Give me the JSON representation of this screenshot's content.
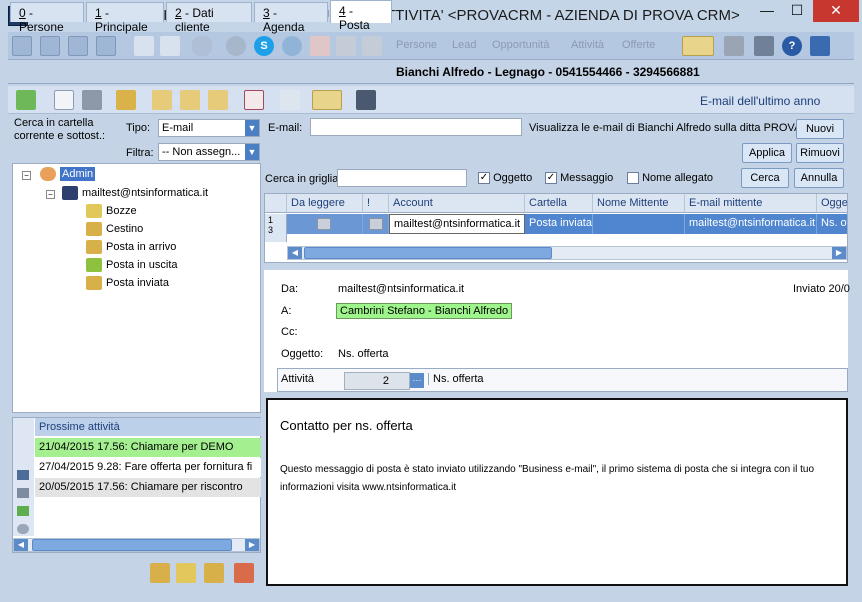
{
  "window": {
    "title": "GESTIONE LEAD / OPPORTUNITA' / ATTIVITA' <PROVACRM - AZIENDA DI PROVA CRM>",
    "app_icon": "B 15",
    "minimize": "—",
    "maximize": "☐",
    "close": "✕"
  },
  "toolbar": {
    "menus": [
      "Persone",
      "Lead",
      "Opportunità",
      "Attività",
      "Offerte"
    ]
  },
  "tabs": [
    {
      "key": "0",
      "label": " - Persone"
    },
    {
      "key": "1",
      "label": " - Principale"
    },
    {
      "key": "2",
      "label": " - Dati cliente"
    },
    {
      "key": "3",
      "label": " - Agenda"
    },
    {
      "key": "4",
      "label": " - Posta"
    }
  ],
  "contact_line": "Bianchi Alfredo   - Legnago - 0541554466 - 3294566881",
  "email_heading": "E-mail dell'ultimo anno",
  "filters": {
    "search_label": "Cerca in cartella corrente e sottost.:",
    "tipo_label": "Tipo:",
    "tipo_value": "E-mail",
    "filtra_label": "Filtra:",
    "filtra_value": "-- Non assegn...",
    "email_label": "E-mail:",
    "email_value": "",
    "visualizza_text": "Visualizza le e-mail di Bianchi Alfredo  sulla ditta PROVACRM",
    "nuovi_btn": "Nuovi",
    "applica_btn": "Applica",
    "rimuovi_btn": "Rimuovi"
  },
  "tree": {
    "root": "Admin",
    "account": "mailtest@ntsinformatica.it",
    "folders": [
      "Bozze",
      "Cestino",
      "Posta in arrivo",
      "Posta in uscita",
      "Posta inviata"
    ]
  },
  "activities": {
    "header": "Prossime attività",
    "items": [
      {
        "text": "21/04/2015 17.56: Chiamare per DEMO",
        "color": "#a4ef8f"
      },
      {
        "text": "27/04/2015 9.28: Fare offerta per fornitura fi",
        "color": "#ffffff"
      },
      {
        "text": "20/05/2015 17.56: Chiamare per riscontro",
        "color": "#e3e3e3"
      }
    ]
  },
  "grid_search": {
    "label": "Cerca in griglia",
    "value": "",
    "oggetto_label": "Oggetto",
    "oggetto_checked": true,
    "messaggio_label": "Messaggio",
    "messaggio_checked": true,
    "allegato_label": "Nome allegato",
    "allegato_checked": false,
    "cerca_btn": "Cerca",
    "annulla_btn": "Annulla"
  },
  "grid": {
    "columns": [
      "Da leggere",
      "!",
      "Account",
      "Cartella",
      "Nome Mittente",
      "E-mail mittente",
      "Ogge"
    ],
    "row_num": "1\n3",
    "row": [
      "",
      "",
      "mailtest@ntsinformatica.it",
      "Posta inviata",
      "",
      "mailtest@ntsinformatica.it",
      "Ns. of"
    ]
  },
  "detail": {
    "da_label": "Da:",
    "da_value": "mailtest@ntsinformatica.it",
    "inviato": "Inviato 20/0",
    "a_label": "A:",
    "a_value": "Cambrini Stefano - Bianchi Alfredo",
    "cc_label": "Cc:",
    "cc_value": "",
    "oggetto_label": "Oggetto:",
    "oggetto_value": "Ns. offerta",
    "attivita_label": "Attività",
    "attivita_num": "2",
    "attivita_desc": "Ns. offerta"
  },
  "body": {
    "title": "Contatto per ns. offerta",
    "line1": "Questo messaggio di posta è stato inviato utilizzando \"Business e-mail\", il primo sistema di posta che si integra con il tuo",
    "line2": "informazioni visita www.ntsinformatica.it"
  }
}
